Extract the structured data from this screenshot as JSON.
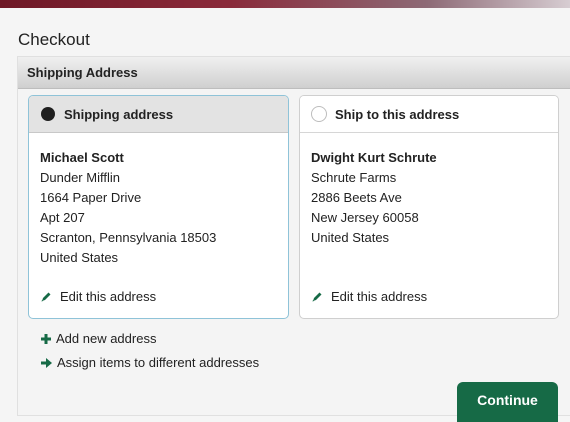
{
  "page": {
    "title": "Checkout"
  },
  "panel": {
    "header": "Shipping Address"
  },
  "cards": [
    {
      "heading": "Shipping address",
      "selected": true,
      "lines": [
        "Michael Scott",
        "Dunder Mifflin",
        "1664 Paper Drive",
        "Apt 207",
        "Scranton, Pennsylvania 18503",
        "United States"
      ],
      "edit_label": "Edit this address"
    },
    {
      "heading": "Ship to this address",
      "selected": false,
      "lines": [
        "Dwight Kurt Schrute",
        "Schrute Farms",
        "2886 Beets Ave",
        "New Jersey 60058",
        "United States"
      ],
      "edit_label": "Edit this address"
    }
  ],
  "actions": {
    "add_new": "Add new address",
    "assign": "Assign items to different addresses",
    "continue": "Continue"
  },
  "icons": {
    "edit": "pencil-icon",
    "add": "plus-icon",
    "assign": "arrow-right-icon",
    "radio_selected": "radio-checked",
    "radio_unselected": "radio-unchecked"
  },
  "colors": {
    "brand_bar": "#6e1826",
    "accent_green": "#166a46",
    "selected_border": "#8fc3d8"
  }
}
